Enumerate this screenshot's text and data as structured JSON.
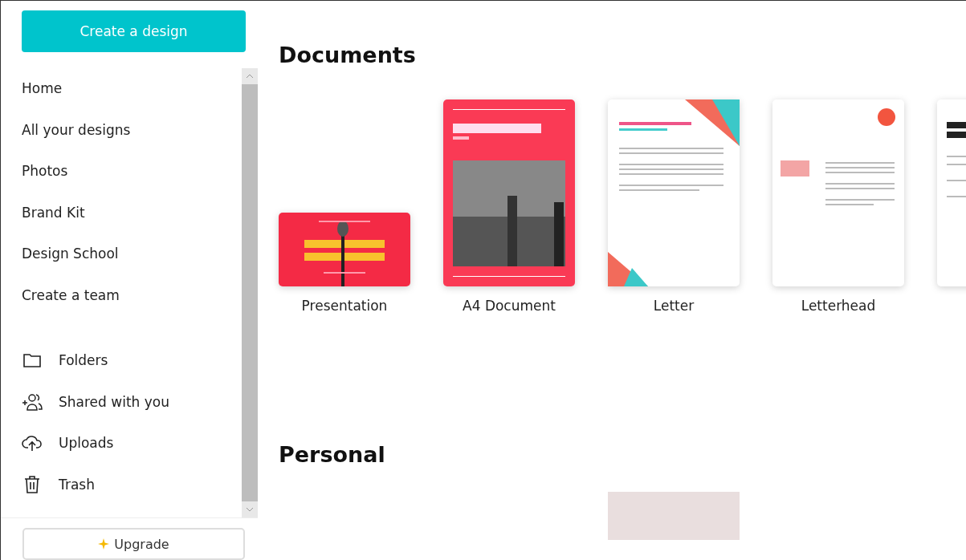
{
  "sidebar": {
    "create_button": "Create a design",
    "nav_items": [
      {
        "label": "Home"
      },
      {
        "label": "All your designs"
      },
      {
        "label": "Photos"
      },
      {
        "label": "Brand Kit"
      },
      {
        "label": "Design School"
      },
      {
        "label": "Create a team"
      }
    ],
    "library_items": [
      {
        "label": "Folders",
        "kind": "folder"
      },
      {
        "label": "Shared with you",
        "kind": "shared"
      },
      {
        "label": "Uploads",
        "kind": "upload"
      },
      {
        "label": "Trash",
        "kind": "trash"
      }
    ],
    "upgrade_button": "Upgrade"
  },
  "sections": [
    {
      "title": "Documents",
      "templates": [
        {
          "label": "Presentation",
          "kind": "presentation"
        },
        {
          "label": "A4 Document",
          "kind": "report"
        },
        {
          "label": "Letter",
          "kind": "letter"
        },
        {
          "label": "Letterhead",
          "kind": "letterhead"
        },
        {
          "kind": "resume"
        }
      ]
    },
    {
      "title": "Personal",
      "templates": [
        {
          "kind": "food-photo"
        }
      ]
    }
  ]
}
